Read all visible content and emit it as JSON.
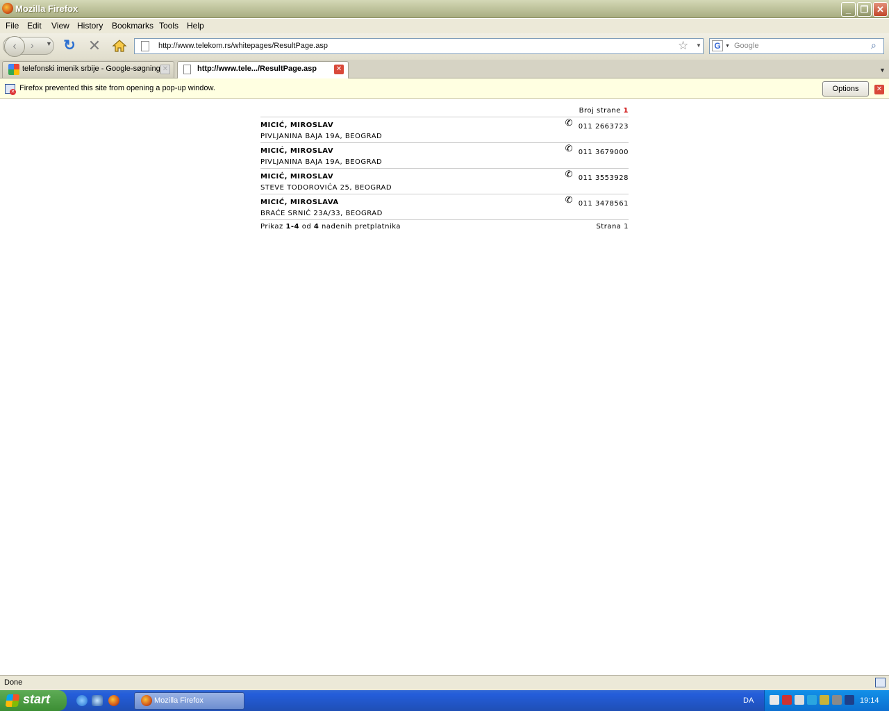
{
  "window": {
    "title": "Mozilla Firefox"
  },
  "menubar": [
    "File",
    "Edit",
    "View",
    "History",
    "Bookmarks",
    "Tools",
    "Help"
  ],
  "navbar": {
    "url": "http://www.telekom.rs/whitepages/ResultPage.asp",
    "search_placeholder": "Google"
  },
  "tabs": [
    {
      "label": "telefonski imenik srbije - Google-søgning",
      "active": false
    },
    {
      "label": "http://www.tele.../ResultPage.asp",
      "active": true
    }
  ],
  "notification": {
    "text": "Firefox prevented this site from opening a pop-up window.",
    "options_label": "Options"
  },
  "results": {
    "page_label": "Broj strane",
    "page_number": "1",
    "entries": [
      {
        "name": "MICIĆ, MIROSLAV",
        "address": "PIVLJANINA BAJA 19A, BEOGRAD",
        "phone": "011 2663723"
      },
      {
        "name": "MICIĆ, MIROSLAV",
        "address": "PIVLJANINA BAJA 19A, BEOGRAD",
        "phone": "011 3679000"
      },
      {
        "name": "MICIĆ, MIROSLAV",
        "address": "STEVE TODOROVIĆA 25, BEOGRAD",
        "phone": "011 3553928"
      },
      {
        "name": "MICIĆ, MIROSLAVA",
        "address": "BRAĆE SRNIĆ 23A/33, BEOGRAD",
        "phone": "011 3478561"
      }
    ],
    "summary_prefix": "Prikaz",
    "summary_range": "1-4",
    "summary_od": "od",
    "summary_total": "4",
    "summary_suffix": "nađenih pretplatnika",
    "bottom_page_label": "Strana",
    "bottom_page_number": "1"
  },
  "statusbar": {
    "text": "Done"
  },
  "taskbar": {
    "start_label": "start",
    "window_button": "Mozilla Firefox",
    "language": "DA",
    "clock": "19:14"
  },
  "colors": {
    "page_number_accent": "#cc0000",
    "taskbar_blue": "#245dda",
    "start_green": "#3c8e34"
  }
}
